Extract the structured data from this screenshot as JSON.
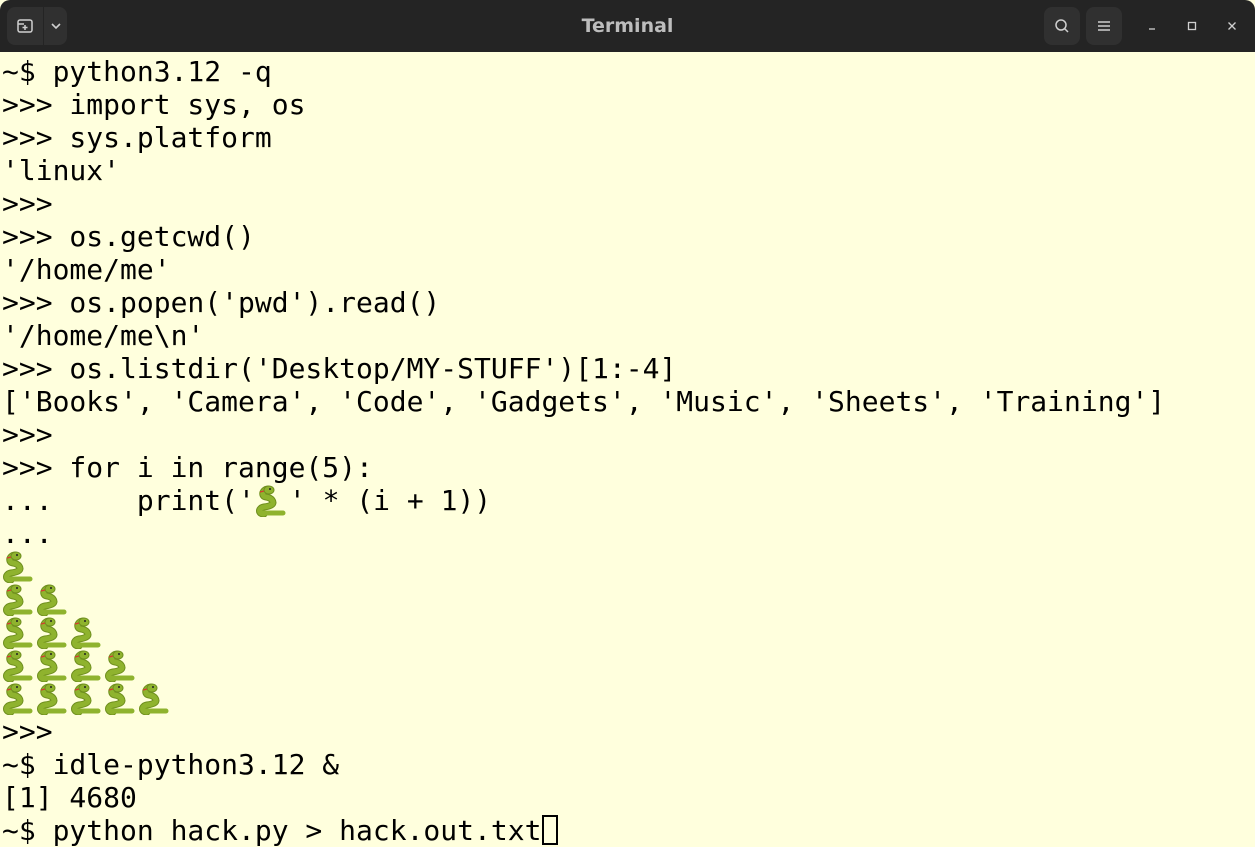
{
  "window": {
    "title": "Terminal"
  },
  "colors": {
    "titlebar_bg": "#242424",
    "terminal_bg": "#ffffdd",
    "terminal_fg": "#000000",
    "snake_green": "#8fb32e"
  },
  "icons": {
    "new_tab": "new-tab-icon",
    "tab_menu": "chevron-down-icon",
    "search": "search-icon",
    "menu": "hamburger-menu-icon",
    "minimize": "minimize-icon",
    "maximize": "maximize-icon",
    "close": "close-icon",
    "snake": "snake-emoji-icon"
  },
  "terminal": {
    "lines": [
      "~$ python3.12 -q",
      ">>> import sys, os",
      ">>> sys.platform",
      "'linux'",
      ">>>",
      ">>> os.getcwd()",
      "'/home/me'",
      ">>> os.popen('pwd').read()",
      "'/home/me\\n'",
      ">>> os.listdir('Desktop/MY-STUFF')[1:-4]",
      "['Books', 'Camera', 'Code', 'Gadgets', 'Music', 'Sheets', 'Training']",
      ">>>",
      ">>> for i in range(5):",
      "...     print('",
      "' * (i + 1))",
      "...",
      ">>>",
      "~$ idle-python3.12 &",
      "[1] 4680",
      "~$ python hack.py > hack.out.txt"
    ],
    "snake_rows": [
      1,
      2,
      3,
      4,
      5
    ]
  }
}
